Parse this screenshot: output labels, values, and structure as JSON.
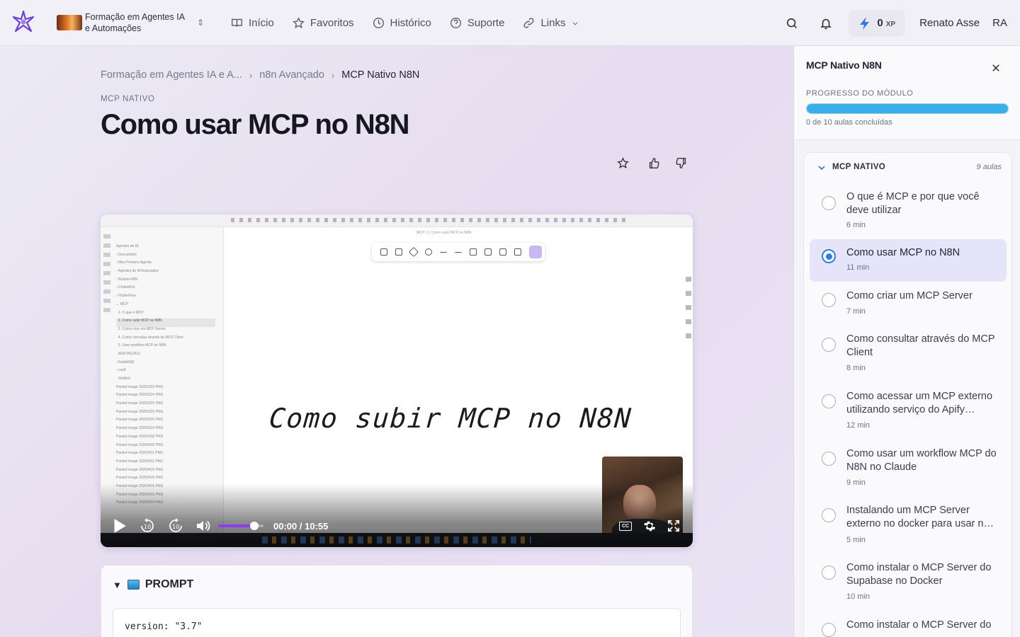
{
  "header": {
    "course_name": "Formação em Agentes IA e Automações",
    "nav": [
      {
        "label": "Início",
        "icon": "book-icon"
      },
      {
        "label": "Favoritos",
        "icon": "star-icon"
      },
      {
        "label": "Histórico",
        "icon": "clock-icon"
      },
      {
        "label": "Suporte",
        "icon": "help-circle-icon"
      },
      {
        "label": "Links",
        "icon": "link-icon"
      }
    ],
    "xp_value": "0",
    "xp_unit": "XP",
    "user_name": "Renato Asse",
    "user_initials": "RA"
  },
  "breadcrumb": {
    "items": [
      "Formação em Agentes IA e A...",
      "n8n Avançado"
    ],
    "current": "MCP Nativo N8N"
  },
  "lesson": {
    "section_label": "MCP NATIVO",
    "title": "Como usar MCP no N8N"
  },
  "video": {
    "handwriting": "Como subir MCP no N8N",
    "time_current": "00:00",
    "time_total": "10:55",
    "volume": 0.8,
    "cc_label": "CC"
  },
  "prompt": {
    "label": "PROMPT",
    "code_line": "version: \"3.7\""
  },
  "panel": {
    "title": "MCP Nativo N8N",
    "progress_label": "PROGRESSO DO MÓDULO",
    "progress_fraction": 1.0,
    "progress_text": "0 de 10 aulas concluídas",
    "module_name": "MCP NATIVO",
    "module_count": "9 aulas",
    "lessons": [
      {
        "title": "O que é MCP e por que você deve utilizar",
        "duration": "6 min"
      },
      {
        "title": "Como usar MCP no N8N",
        "duration": "11 min"
      },
      {
        "title": "Como criar um MCP Server",
        "duration": "7 min"
      },
      {
        "title": "Como consultar através do MCP Client",
        "duration": "8 min"
      },
      {
        "title": "Como acessar um MCP externo utilizando serviço do Apify…",
        "duration": "12 min"
      },
      {
        "title": "Como usar um workflow MCP do N8N no Claude",
        "duration": "9 min"
      },
      {
        "title": "Instalando um MCP Server externo no docker para usar n…",
        "duration": "5 min"
      },
      {
        "title": "Como instalar o MCP Server do Supabase no Docker",
        "duration": "10 min"
      },
      {
        "title": "Como instalar o MCP Server do",
        "duration": ""
      }
    ],
    "active_lesson": 1
  },
  "colors": {
    "accent_purple": "#8b3ff0",
    "progress_blue": "#3aaee8",
    "active_radio": "#2f7de0"
  }
}
